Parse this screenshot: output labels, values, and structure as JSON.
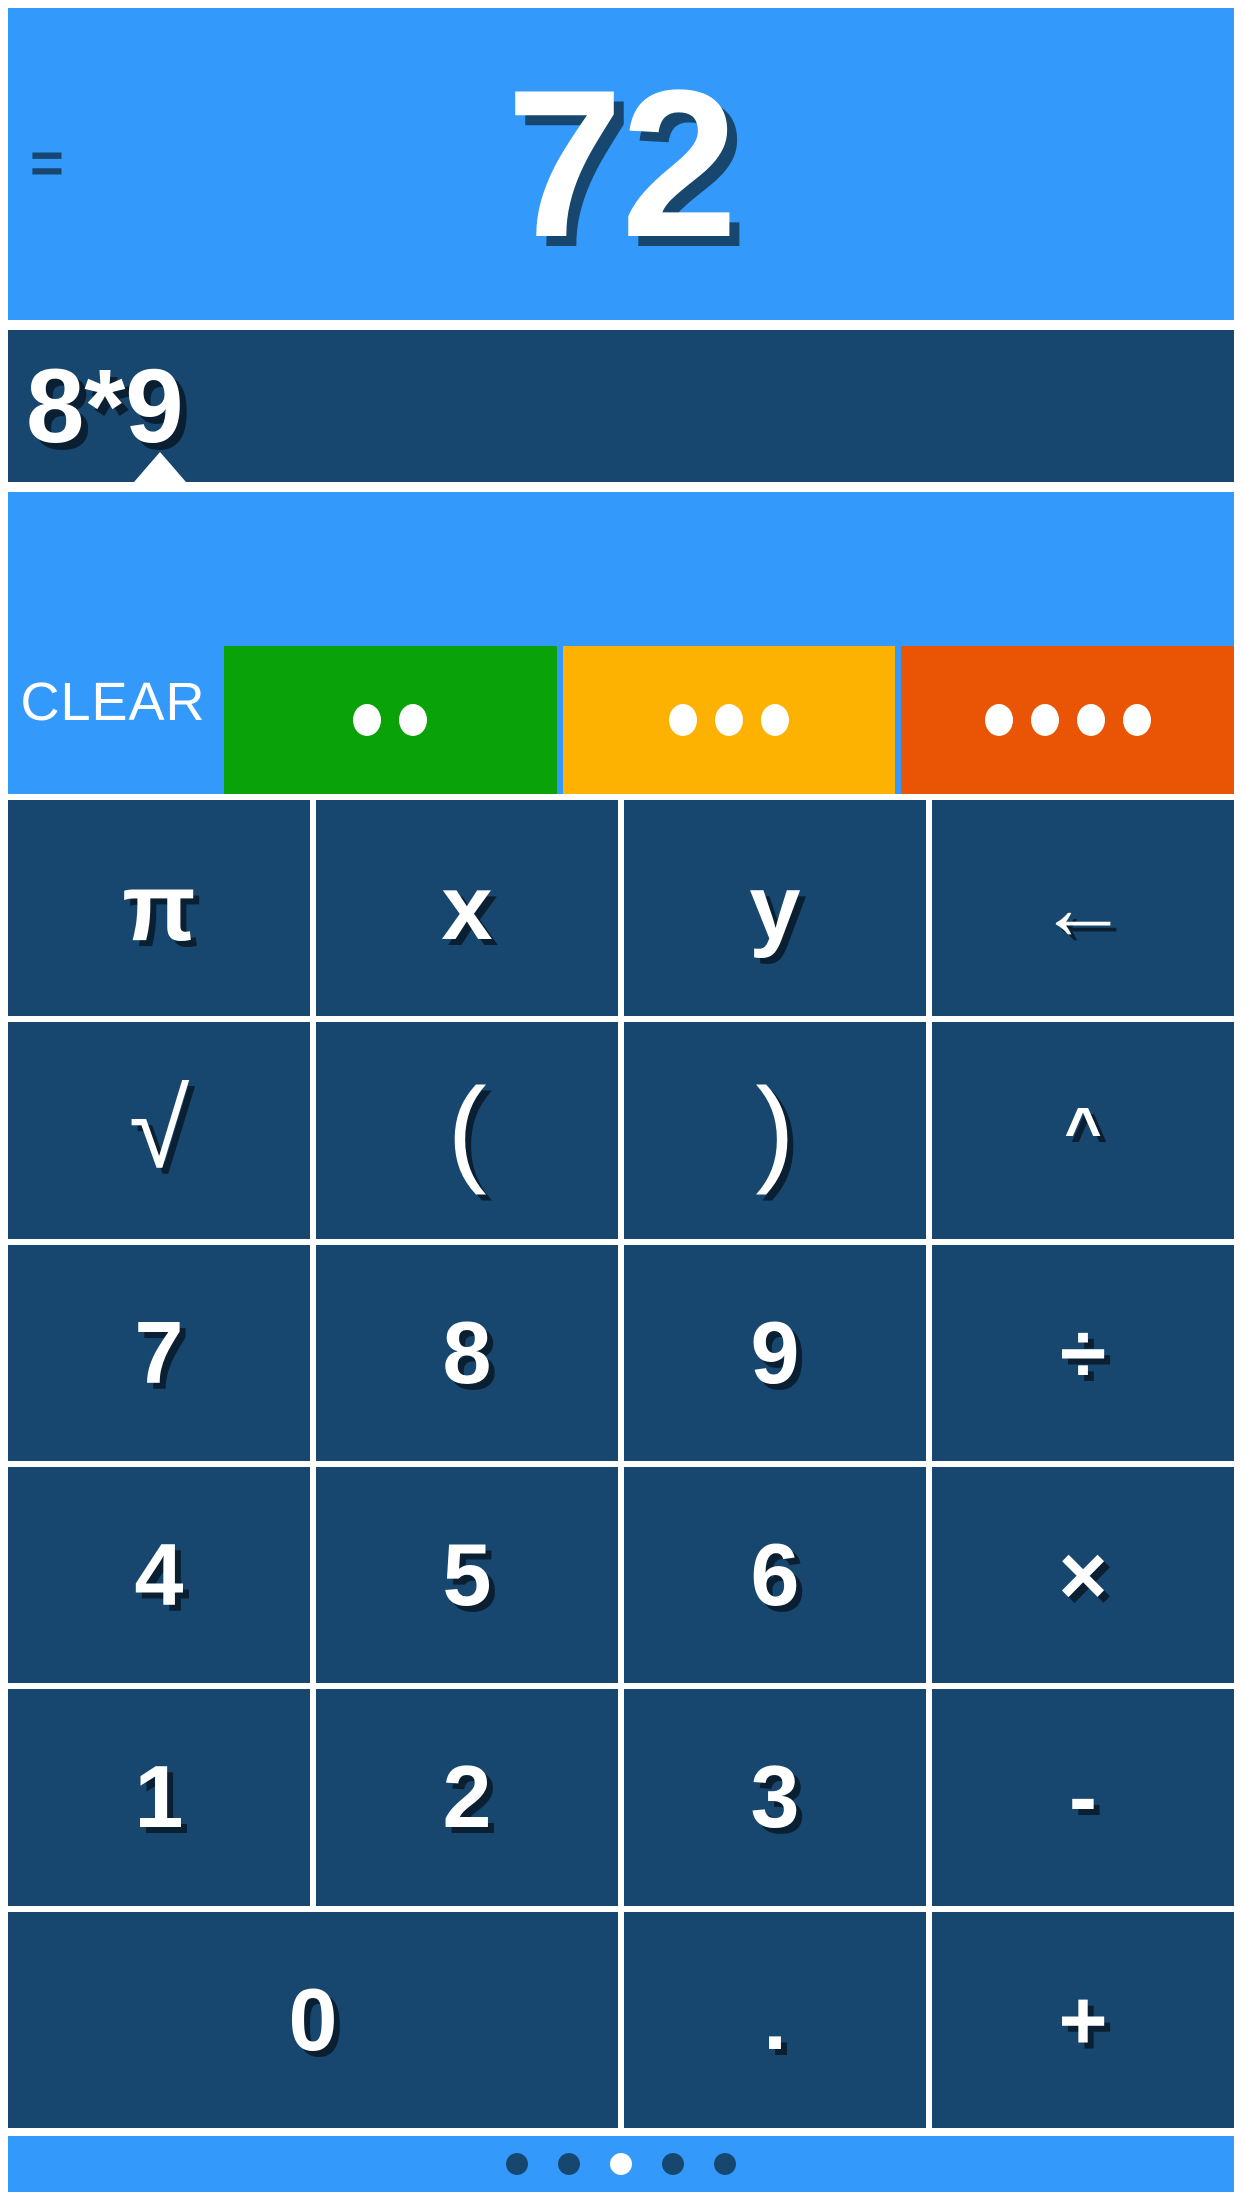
{
  "display": {
    "equals_sign": "=",
    "result": "72",
    "expression": "8*9",
    "cursor_icon": "caret-triangle-icon",
    "bg_color": "#3399fb",
    "expression_bg_color": "#17476f",
    "text_color": "#ffffff"
  },
  "actions": {
    "clear_label": "CLEAR",
    "memory_buttons": [
      {
        "name": "green-dots-button",
        "dots": 2,
        "color": "#09a309"
      },
      {
        "name": "amber-dots-button",
        "dots": 3,
        "color": "#fdb201"
      },
      {
        "name": "orange-dots-button",
        "dots": 4,
        "color": "#ea5505"
      }
    ]
  },
  "keypad": {
    "rows": [
      [
        {
          "label": "π",
          "name": "key-pi",
          "style": "sym-pi",
          "span": 1
        },
        {
          "label": "x",
          "name": "key-x",
          "style": "sym-var",
          "span": 1
        },
        {
          "label": "y",
          "name": "key-y",
          "style": "sym-var",
          "span": 1
        },
        {
          "label": "←",
          "name": "key-backspace",
          "style": "sym-arrow",
          "span": 1
        }
      ],
      [
        {
          "label": "√",
          "name": "key-square-root",
          "style": "sym-sqrt",
          "span": 1
        },
        {
          "label": "(",
          "name": "key-open-paren",
          "style": "sym-paren",
          "span": 1
        },
        {
          "label": ")",
          "name": "key-close-paren",
          "style": "sym-paren",
          "span": 1
        },
        {
          "label": "^",
          "name": "key-power",
          "style": "sym-caret",
          "span": 1
        }
      ],
      [
        {
          "label": "7",
          "name": "key-7",
          "style": "",
          "span": 1
        },
        {
          "label": "8",
          "name": "key-8",
          "style": "",
          "span": 1
        },
        {
          "label": "9",
          "name": "key-9",
          "style": "",
          "span": 1
        },
        {
          "label": "÷",
          "name": "key-divide",
          "style": "sym-op",
          "span": 1
        }
      ],
      [
        {
          "label": "4",
          "name": "key-4",
          "style": "",
          "span": 1
        },
        {
          "label": "5",
          "name": "key-5",
          "style": "",
          "span": 1
        },
        {
          "label": "6",
          "name": "key-6",
          "style": "",
          "span": 1
        },
        {
          "label": "×",
          "name": "key-multiply",
          "style": "sym-op",
          "span": 1
        }
      ],
      [
        {
          "label": "1",
          "name": "key-1",
          "style": "",
          "span": 1
        },
        {
          "label": "2",
          "name": "key-2",
          "style": "",
          "span": 1
        },
        {
          "label": "3",
          "name": "key-3",
          "style": "",
          "span": 1
        },
        {
          "label": "-",
          "name": "key-minus",
          "style": "sym-op",
          "span": 1
        }
      ],
      [
        {
          "label": "0",
          "name": "key-0",
          "style": "",
          "span": 2
        },
        {
          "label": ".",
          "name": "key-decimal-point",
          "style": "sym-dot",
          "span": 1
        },
        {
          "label": "+",
          "name": "key-plus",
          "style": "sym-op",
          "span": 1
        }
      ]
    ]
  },
  "page_indicator": {
    "total": 5,
    "active_index": 2
  }
}
